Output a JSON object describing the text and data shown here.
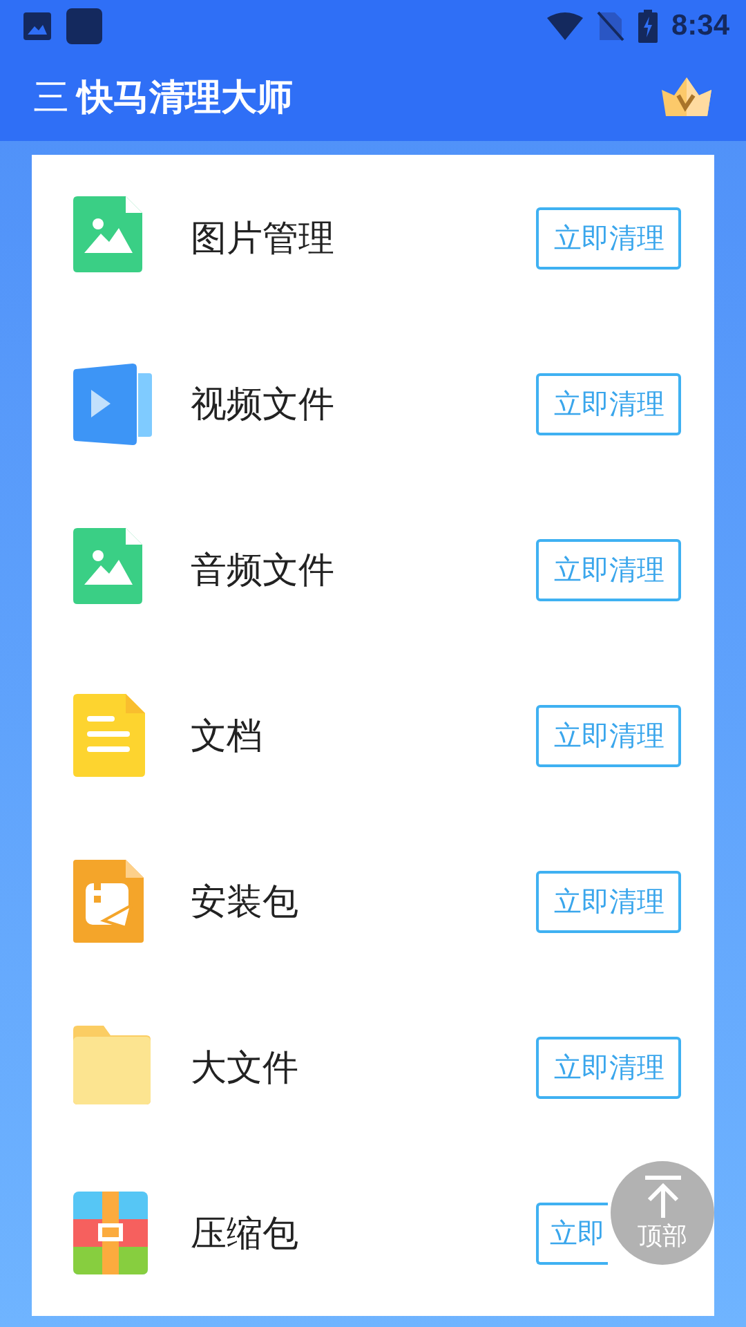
{
  "status_bar": {
    "time": "8:34"
  },
  "app_bar": {
    "menu_glyph": "三",
    "title": "快马清理大师"
  },
  "items": [
    {
      "kind": "image",
      "label": "图片管理",
      "button": "立即清理"
    },
    {
      "kind": "video",
      "label": "视频文件",
      "button": "立即清理"
    },
    {
      "kind": "image",
      "label": "音频文件",
      "button": "立即清理"
    },
    {
      "kind": "doc",
      "label": "文档",
      "button": "立即清理"
    },
    {
      "kind": "apk",
      "label": "安装包",
      "button": "立即清理"
    },
    {
      "kind": "folder",
      "label": "大文件",
      "button": "立即清理"
    },
    {
      "kind": "zip",
      "label": "压缩包",
      "button": "立即",
      "covered": true
    }
  ],
  "top_button": {
    "label": "顶部"
  }
}
